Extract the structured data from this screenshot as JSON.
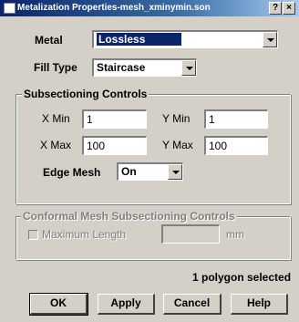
{
  "window": {
    "title": "Metalization Properties-mesh_xminymin.son",
    "help_glyph": "?",
    "close_glyph": "×"
  },
  "metal": {
    "label": "Metal",
    "value": "Lossless"
  },
  "fill_type": {
    "label": "Fill Type",
    "value": "Staircase"
  },
  "subsectioning": {
    "title": "Subsectioning Controls",
    "xmin": {
      "label": "X Min",
      "value": "1"
    },
    "ymin": {
      "label": "Y Min",
      "value": "1"
    },
    "xmax": {
      "label": "X Max",
      "value": "100"
    },
    "ymax": {
      "label": "Y Max",
      "value": "100"
    },
    "edge_mesh": {
      "label": "Edge Mesh",
      "value": "On"
    }
  },
  "conformal": {
    "title": "Conformal Mesh Subsectioning Controls",
    "max_length_label": "Maximum Length",
    "max_length_value": "",
    "unit": "mm",
    "checkbox_glyph": "☐"
  },
  "status": {
    "text": "1 polygon selected"
  },
  "buttons": {
    "ok": "OK",
    "apply": "Apply",
    "cancel": "Cancel",
    "help": "Help"
  }
}
